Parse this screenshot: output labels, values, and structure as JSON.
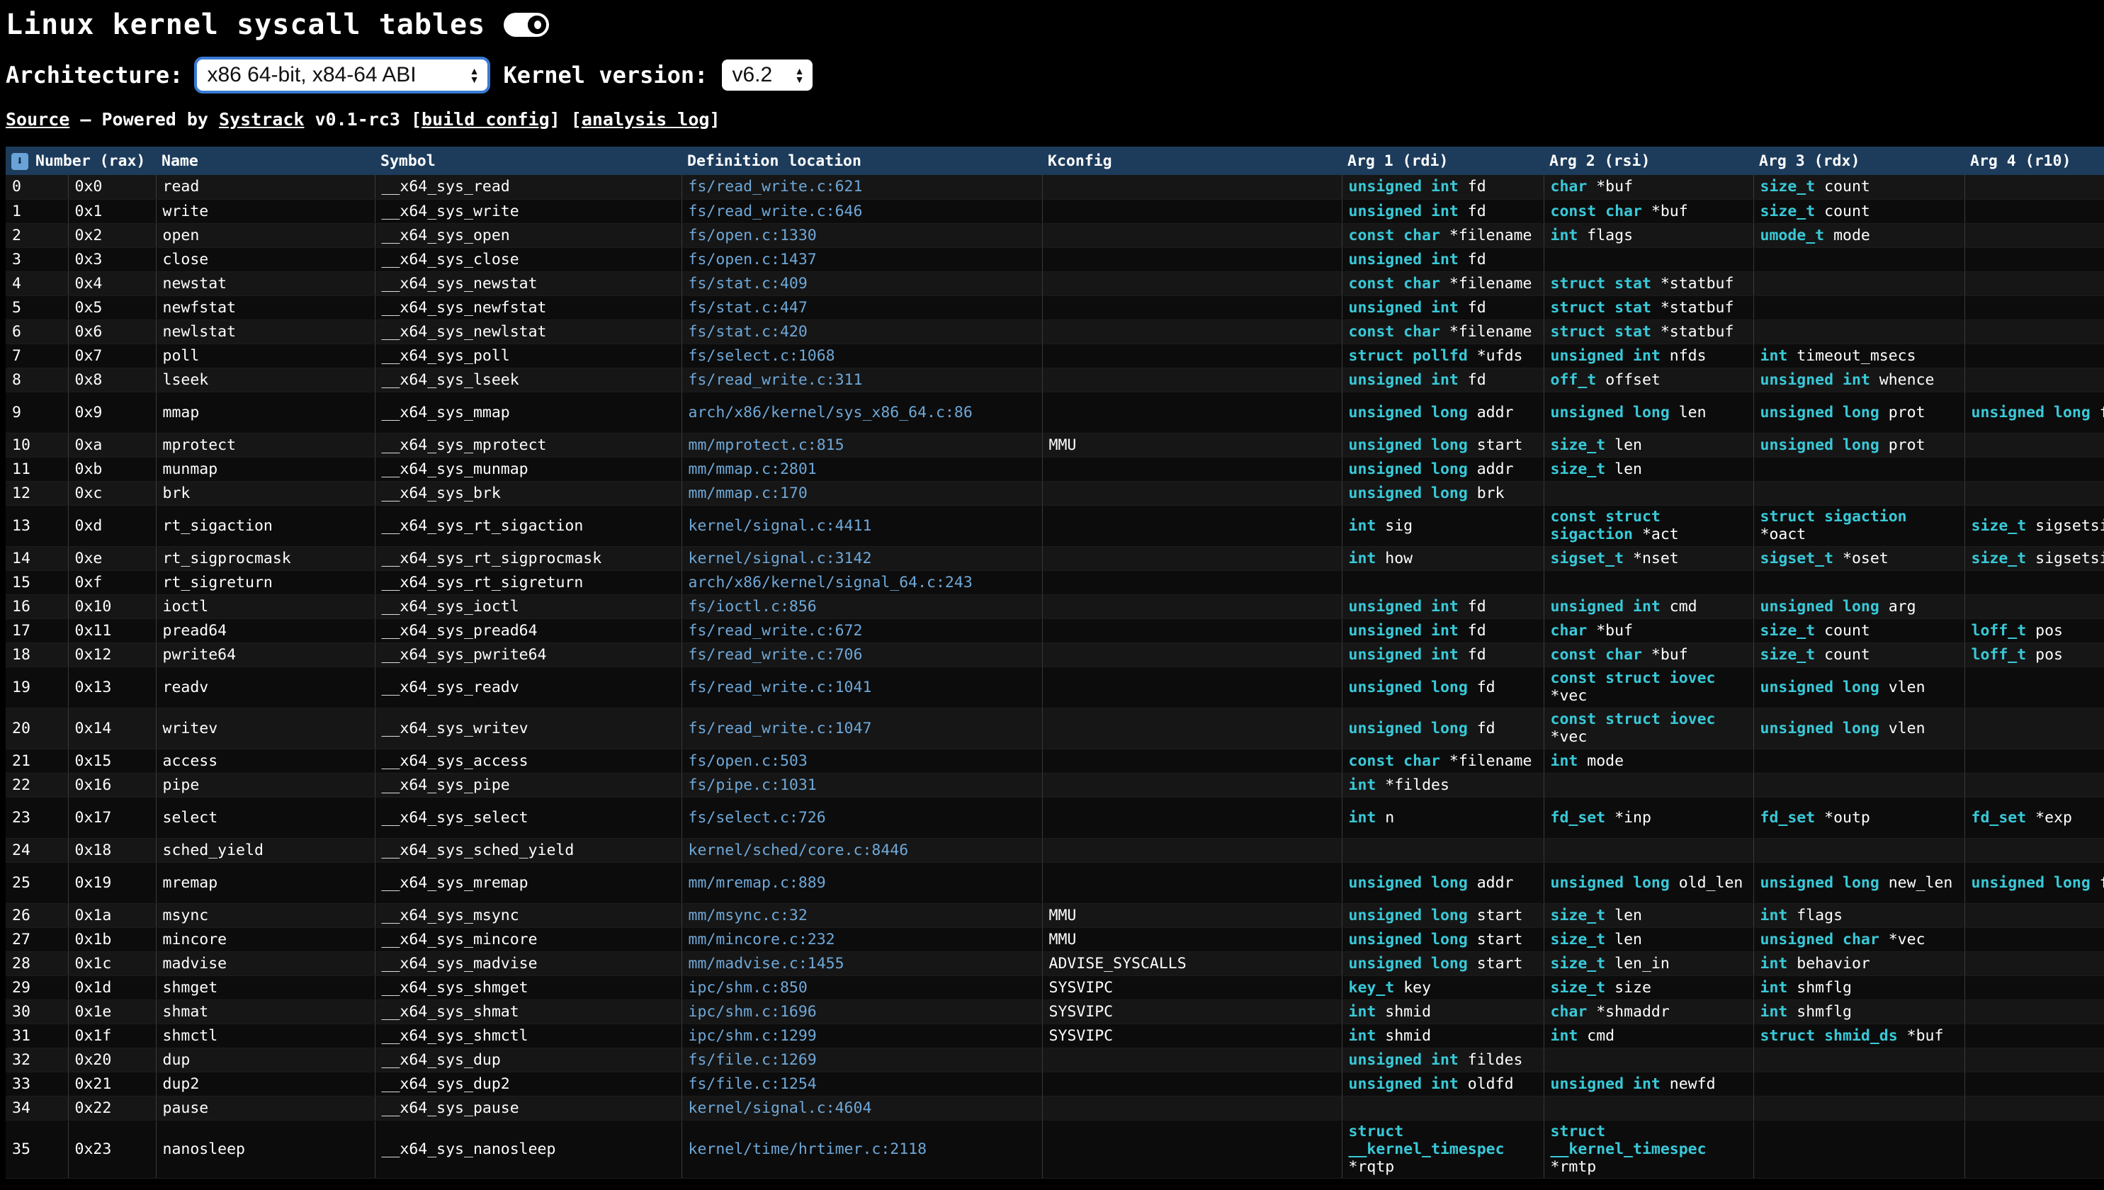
{
  "title": "Linux kernel syscall tables",
  "architecture_label": "Architecture:",
  "architecture_value": "x86 64-bit, x84-64 ABI",
  "kernel_label": "Kernel version:",
  "kernel_value": "v6.2",
  "source": {
    "source_link": "Source",
    "dash": " — Powered by ",
    "systrack_link": "Systrack",
    "version": " v0.1-rc3 [",
    "build_link": "build config",
    "mid": "] [",
    "analysis_link": "analysis log",
    "end": "]"
  },
  "headers": [
    "Number (rax)",
    "Name",
    "Symbol",
    "Definition location",
    "Kconfig",
    "Arg 1 (rdi)",
    "Arg 2 (rsi)",
    "Arg 3 (rdx)",
    "Arg 4 (r10)"
  ],
  "rows": [
    {
      "n": "0",
      "hex": "0x0",
      "name": "read",
      "sym": "__x64_sys_read",
      "loc": "fs/read_write.c:621",
      "kc": "",
      "h": 34,
      "args": [
        [
          "unsigned int",
          "fd"
        ],
        [
          "char",
          "*buf"
        ],
        [
          "size_t",
          "count"
        ],
        [
          "",
          ""
        ]
      ]
    },
    {
      "n": "1",
      "hex": "0x1",
      "name": "write",
      "sym": "__x64_sys_write",
      "loc": "fs/read_write.c:646",
      "kc": "",
      "h": 34,
      "args": [
        [
          "unsigned int",
          "fd"
        ],
        [
          "const char",
          "*buf"
        ],
        [
          "size_t",
          "count"
        ],
        [
          "",
          ""
        ]
      ]
    },
    {
      "n": "2",
      "hex": "0x2",
      "name": "open",
      "sym": "__x64_sys_open",
      "loc": "fs/open.c:1330",
      "kc": "",
      "h": 34,
      "args": [
        [
          "const char",
          "*filename"
        ],
        [
          "int",
          "flags"
        ],
        [
          "umode_t",
          "mode"
        ],
        [
          "",
          ""
        ]
      ]
    },
    {
      "n": "3",
      "hex": "0x3",
      "name": "close",
      "sym": "__x64_sys_close",
      "loc": "fs/open.c:1437",
      "kc": "",
      "h": 34,
      "args": [
        [
          "unsigned int",
          "fd"
        ],
        [
          "",
          ""
        ],
        [
          "",
          ""
        ],
        [
          "",
          ""
        ]
      ]
    },
    {
      "n": "4",
      "hex": "0x4",
      "name": "newstat",
      "sym": "__x64_sys_newstat",
      "loc": "fs/stat.c:409",
      "kc": "",
      "h": 34,
      "args": [
        [
          "const char",
          "*filename"
        ],
        [
          "struct stat",
          "*statbuf"
        ],
        [
          "",
          ""
        ],
        [
          "",
          ""
        ]
      ]
    },
    {
      "n": "5",
      "hex": "0x5",
      "name": "newfstat",
      "sym": "__x64_sys_newfstat",
      "loc": "fs/stat.c:447",
      "kc": "",
      "h": 34,
      "args": [
        [
          "unsigned int",
          "fd"
        ],
        [
          "struct stat",
          "*statbuf"
        ],
        [
          "",
          ""
        ],
        [
          "",
          ""
        ]
      ]
    },
    {
      "n": "6",
      "hex": "0x6",
      "name": "newlstat",
      "sym": "__x64_sys_newlstat",
      "loc": "fs/stat.c:420",
      "kc": "",
      "h": 34,
      "args": [
        [
          "const char",
          "*filename"
        ],
        [
          "struct stat",
          "*statbuf"
        ],
        [
          "",
          ""
        ],
        [
          "",
          ""
        ]
      ]
    },
    {
      "n": "7",
      "hex": "0x7",
      "name": "poll",
      "sym": "__x64_sys_poll",
      "loc": "fs/select.c:1068",
      "kc": "",
      "h": 34,
      "args": [
        [
          "struct pollfd",
          "*ufds"
        ],
        [
          "unsigned int",
          "nfds"
        ],
        [
          "int",
          "timeout_msecs"
        ],
        [
          "",
          ""
        ]
      ]
    },
    {
      "n": "8",
      "hex": "0x8",
      "name": "lseek",
      "sym": "__x64_sys_lseek",
      "loc": "fs/read_write.c:311",
      "kc": "",
      "h": 34,
      "args": [
        [
          "unsigned int",
          "fd"
        ],
        [
          "off_t",
          "offset"
        ],
        [
          "unsigned int",
          "whence"
        ],
        [
          "",
          ""
        ]
      ]
    },
    {
      "n": "9",
      "hex": "0x9",
      "name": "mmap",
      "sym": "__x64_sys_mmap",
      "loc": "arch/x86/kernel/sys_x86_64.c:86",
      "kc": "",
      "h": 58,
      "args": [
        [
          "unsigned long",
          "addr"
        ],
        [
          "unsigned long",
          "len"
        ],
        [
          "unsigned long",
          "prot"
        ],
        [
          "unsigned long",
          "flags"
        ]
      ]
    },
    {
      "n": "10",
      "hex": "0xa",
      "name": "mprotect",
      "sym": "__x64_sys_mprotect",
      "loc": "mm/mprotect.c:815",
      "kc": "MMU",
      "h": 34,
      "args": [
        [
          "unsigned long",
          "start"
        ],
        [
          "size_t",
          "len"
        ],
        [
          "unsigned long",
          "prot"
        ],
        [
          "",
          ""
        ]
      ]
    },
    {
      "n": "11",
      "hex": "0xb",
      "name": "munmap",
      "sym": "__x64_sys_munmap",
      "loc": "mm/mmap.c:2801",
      "kc": "",
      "h": 34,
      "args": [
        [
          "unsigned long",
          "addr"
        ],
        [
          "size_t",
          "len"
        ],
        [
          "",
          ""
        ],
        [
          "",
          ""
        ]
      ]
    },
    {
      "n": "12",
      "hex": "0xc",
      "name": "brk",
      "sym": "__x64_sys_brk",
      "loc": "mm/mmap.c:170",
      "kc": "",
      "h": 34,
      "args": [
        [
          "unsigned long",
          "brk"
        ],
        [
          "",
          ""
        ],
        [
          "",
          ""
        ],
        [
          "",
          ""
        ]
      ]
    },
    {
      "n": "13",
      "hex": "0xd",
      "name": "rt_sigaction",
      "sym": "__x64_sys_rt_sigaction",
      "loc": "kernel/signal.c:4411",
      "kc": "",
      "h": 58,
      "args": [
        [
          "int",
          "sig"
        ],
        [
          "const struct sigaction",
          "*act"
        ],
        [
          "struct sigaction",
          "*oact"
        ],
        [
          "size_t",
          "sigsetsize"
        ]
      ]
    },
    {
      "n": "14",
      "hex": "0xe",
      "name": "rt_sigprocmask",
      "sym": "__x64_sys_rt_sigprocmask",
      "loc": "kernel/signal.c:3142",
      "kc": "",
      "h": 34,
      "args": [
        [
          "int",
          "how"
        ],
        [
          "sigset_t",
          "*nset"
        ],
        [
          "sigset_t",
          "*oset"
        ],
        [
          "size_t",
          "sigsetsize"
        ]
      ]
    },
    {
      "n": "15",
      "hex": "0xf",
      "name": "rt_sigreturn",
      "sym": "__x64_sys_rt_sigreturn",
      "loc": "arch/x86/kernel/signal_64.c:243",
      "kc": "",
      "h": 34,
      "args": [
        [
          "",
          ""
        ],
        [
          "",
          ""
        ],
        [
          "",
          ""
        ],
        [
          "",
          ""
        ]
      ]
    },
    {
      "n": "16",
      "hex": "0x10",
      "name": "ioctl",
      "sym": "__x64_sys_ioctl",
      "loc": "fs/ioctl.c:856",
      "kc": "",
      "h": 34,
      "args": [
        [
          "unsigned int",
          "fd"
        ],
        [
          "unsigned int",
          "cmd"
        ],
        [
          "unsigned long",
          "arg"
        ],
        [
          "",
          ""
        ]
      ]
    },
    {
      "n": "17",
      "hex": "0x11",
      "name": "pread64",
      "sym": "__x64_sys_pread64",
      "loc": "fs/read_write.c:672",
      "kc": "",
      "h": 34,
      "args": [
        [
          "unsigned int",
          "fd"
        ],
        [
          "char",
          "*buf"
        ],
        [
          "size_t",
          "count"
        ],
        [
          "loff_t",
          "pos"
        ]
      ]
    },
    {
      "n": "18",
      "hex": "0x12",
      "name": "pwrite64",
      "sym": "__x64_sys_pwrite64",
      "loc": "fs/read_write.c:706",
      "kc": "",
      "h": 34,
      "args": [
        [
          "unsigned int",
          "fd"
        ],
        [
          "const char",
          "*buf"
        ],
        [
          "size_t",
          "count"
        ],
        [
          "loff_t",
          "pos"
        ]
      ]
    },
    {
      "n": "19",
      "hex": "0x13",
      "name": "readv",
      "sym": "__x64_sys_readv",
      "loc": "fs/read_write.c:1041",
      "kc": "",
      "h": 58,
      "args": [
        [
          "unsigned long",
          "fd"
        ],
        [
          "const struct iovec",
          "*vec"
        ],
        [
          "unsigned long",
          "vlen"
        ],
        [
          "",
          ""
        ]
      ]
    },
    {
      "n": "20",
      "hex": "0x14",
      "name": "writev",
      "sym": "__x64_sys_writev",
      "loc": "fs/read_write.c:1047",
      "kc": "",
      "h": 58,
      "args": [
        [
          "unsigned long",
          "fd"
        ],
        [
          "const struct iovec",
          "*vec"
        ],
        [
          "unsigned long",
          "vlen"
        ],
        [
          "",
          ""
        ]
      ]
    },
    {
      "n": "21",
      "hex": "0x15",
      "name": "access",
      "sym": "__x64_sys_access",
      "loc": "fs/open.c:503",
      "kc": "",
      "h": 34,
      "args": [
        [
          "const char",
          "*filename"
        ],
        [
          "int",
          "mode"
        ],
        [
          "",
          ""
        ],
        [
          "",
          ""
        ]
      ]
    },
    {
      "n": "22",
      "hex": "0x16",
      "name": "pipe",
      "sym": "__x64_sys_pipe",
      "loc": "fs/pipe.c:1031",
      "kc": "",
      "h": 34,
      "args": [
        [
          "int",
          "*fildes"
        ],
        [
          "",
          ""
        ],
        [
          "",
          ""
        ],
        [
          "",
          ""
        ]
      ]
    },
    {
      "n": "23",
      "hex": "0x17",
      "name": "select",
      "sym": "__x64_sys_select",
      "loc": "fs/select.c:726",
      "kc": "",
      "h": 58,
      "args": [
        [
          "int",
          "n"
        ],
        [
          "fd_set",
          "*inp"
        ],
        [
          "fd_set",
          "*outp"
        ],
        [
          "fd_set",
          "*exp"
        ]
      ]
    },
    {
      "n": "24",
      "hex": "0x18",
      "name": "sched_yield",
      "sym": "__x64_sys_sched_yield",
      "loc": "kernel/sched/core.c:8446",
      "kc": "",
      "h": 34,
      "args": [
        [
          "",
          ""
        ],
        [
          "",
          ""
        ],
        [
          "",
          ""
        ],
        [
          "",
          ""
        ]
      ]
    },
    {
      "n": "25",
      "hex": "0x19",
      "name": "mremap",
      "sym": "__x64_sys_mremap",
      "loc": "mm/mremap.c:889",
      "kc": "",
      "h": 58,
      "args": [
        [
          "unsigned long",
          "addr"
        ],
        [
          "unsigned long",
          "old_len"
        ],
        [
          "unsigned long",
          "new_len"
        ],
        [
          "unsigned long",
          "flags"
        ]
      ]
    },
    {
      "n": "26",
      "hex": "0x1a",
      "name": "msync",
      "sym": "__x64_sys_msync",
      "loc": "mm/msync.c:32",
      "kc": "MMU",
      "h": 34,
      "args": [
        [
          "unsigned long",
          "start"
        ],
        [
          "size_t",
          "len"
        ],
        [
          "int",
          "flags"
        ],
        [
          "",
          ""
        ]
      ]
    },
    {
      "n": "27",
      "hex": "0x1b",
      "name": "mincore",
      "sym": "__x64_sys_mincore",
      "loc": "mm/mincore.c:232",
      "kc": "MMU",
      "h": 34,
      "args": [
        [
          "unsigned long",
          "start"
        ],
        [
          "size_t",
          "len"
        ],
        [
          "unsigned char",
          "*vec"
        ],
        [
          "",
          ""
        ]
      ]
    },
    {
      "n": "28",
      "hex": "0x1c",
      "name": "madvise",
      "sym": "__x64_sys_madvise",
      "loc": "mm/madvise.c:1455",
      "kc": "ADVISE_SYSCALLS",
      "h": 34,
      "args": [
        [
          "unsigned long",
          "start"
        ],
        [
          "size_t",
          "len_in"
        ],
        [
          "int",
          "behavior"
        ],
        [
          "",
          ""
        ]
      ]
    },
    {
      "n": "29",
      "hex": "0x1d",
      "name": "shmget",
      "sym": "__x64_sys_shmget",
      "loc": "ipc/shm.c:850",
      "kc": "SYSVIPC",
      "h": 34,
      "args": [
        [
          "key_t",
          "key"
        ],
        [
          "size_t",
          "size"
        ],
        [
          "int",
          "shmflg"
        ],
        [
          "",
          ""
        ]
      ]
    },
    {
      "n": "30",
      "hex": "0x1e",
      "name": "shmat",
      "sym": "__x64_sys_shmat",
      "loc": "ipc/shm.c:1696",
      "kc": "SYSVIPC",
      "h": 34,
      "args": [
        [
          "int",
          "shmid"
        ],
        [
          "char",
          "*shmaddr"
        ],
        [
          "int",
          "shmflg"
        ],
        [
          "",
          ""
        ]
      ]
    },
    {
      "n": "31",
      "hex": "0x1f",
      "name": "shmctl",
      "sym": "__x64_sys_shmctl",
      "loc": "ipc/shm.c:1299",
      "kc": "SYSVIPC",
      "h": 34,
      "args": [
        [
          "int",
          "shmid"
        ],
        [
          "int",
          "cmd"
        ],
        [
          "struct shmid_ds",
          "*buf"
        ],
        [
          "",
          ""
        ]
      ]
    },
    {
      "n": "32",
      "hex": "0x20",
      "name": "dup",
      "sym": "__x64_sys_dup",
      "loc": "fs/file.c:1269",
      "kc": "",
      "h": 34,
      "args": [
        [
          "unsigned int",
          "fildes"
        ],
        [
          "",
          ""
        ],
        [
          "",
          ""
        ],
        [
          "",
          ""
        ]
      ]
    },
    {
      "n": "33",
      "hex": "0x21",
      "name": "dup2",
      "sym": "__x64_sys_dup2",
      "loc": "fs/file.c:1254",
      "kc": "",
      "h": 34,
      "args": [
        [
          "unsigned int",
          "oldfd"
        ],
        [
          "unsigned int",
          "newfd"
        ],
        [
          "",
          ""
        ],
        [
          "",
          ""
        ]
      ]
    },
    {
      "n": "34",
      "hex": "0x22",
      "name": "pause",
      "sym": "__x64_sys_pause",
      "loc": "kernel/signal.c:4604",
      "kc": "",
      "h": 34,
      "args": [
        [
          "",
          ""
        ],
        [
          "",
          ""
        ],
        [
          "",
          ""
        ],
        [
          "",
          ""
        ]
      ]
    },
    {
      "n": "35",
      "hex": "0x23",
      "name": "nanosleep",
      "sym": "__x64_sys_nanosleep",
      "loc": "kernel/time/hrtimer.c:2118",
      "kc": "",
      "h": 82,
      "args": [
        [
          "struct __kernel_timespec",
          "*rqtp"
        ],
        [
          "struct __kernel_timespec",
          "*rmtp"
        ],
        [
          "",
          ""
        ],
        [
          "",
          ""
        ]
      ]
    }
  ]
}
